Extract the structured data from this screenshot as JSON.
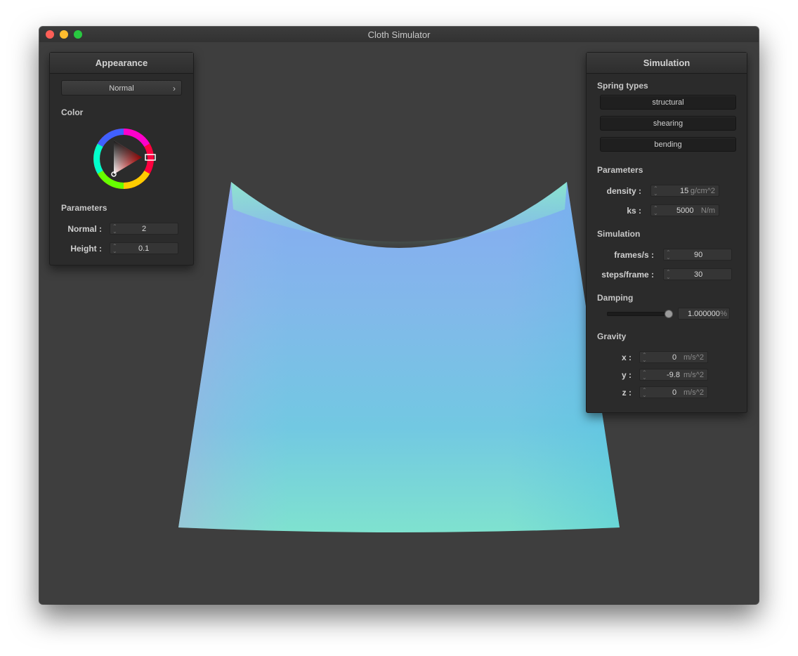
{
  "window": {
    "title": "Cloth Simulator"
  },
  "appearance": {
    "title": "Appearance",
    "shader_select": "Normal",
    "color_label": "Color",
    "parameters_label": "Parameters",
    "normal_label": "Normal :",
    "normal_value": "2",
    "height_label": "Height :",
    "height_value": "0.1"
  },
  "simulation_panel": {
    "title": "Simulation",
    "spring_types_label": "Spring types",
    "spring_buttons": [
      "structural",
      "shearing",
      "bending"
    ],
    "parameters_label": "Parameters",
    "density_label": "density :",
    "density_value": "15",
    "density_unit": "g/cm^2",
    "ks_label": "ks :",
    "ks_value": "5000",
    "ks_unit": "N/m",
    "simulation_label": "Simulation",
    "fps_label": "frames/s :",
    "fps_value": "90",
    "steps_label": "steps/frame :",
    "steps_value": "30",
    "damping_label": "Damping",
    "damping_fraction": 1.0,
    "damping_value": "1.000000",
    "damping_unit": "%",
    "gravity_label": "Gravity",
    "gx_label": "x :",
    "gx_value": "0",
    "gy_label": "y :",
    "gy_value": "-9.8",
    "gz_label": "z :",
    "gz_value": "0",
    "gravity_unit": "m/s^2"
  },
  "colors": {
    "selected_color": "#ff0000",
    "cloth_top": "#7fb0f0",
    "cloth_bottom": "#7de0d2"
  }
}
